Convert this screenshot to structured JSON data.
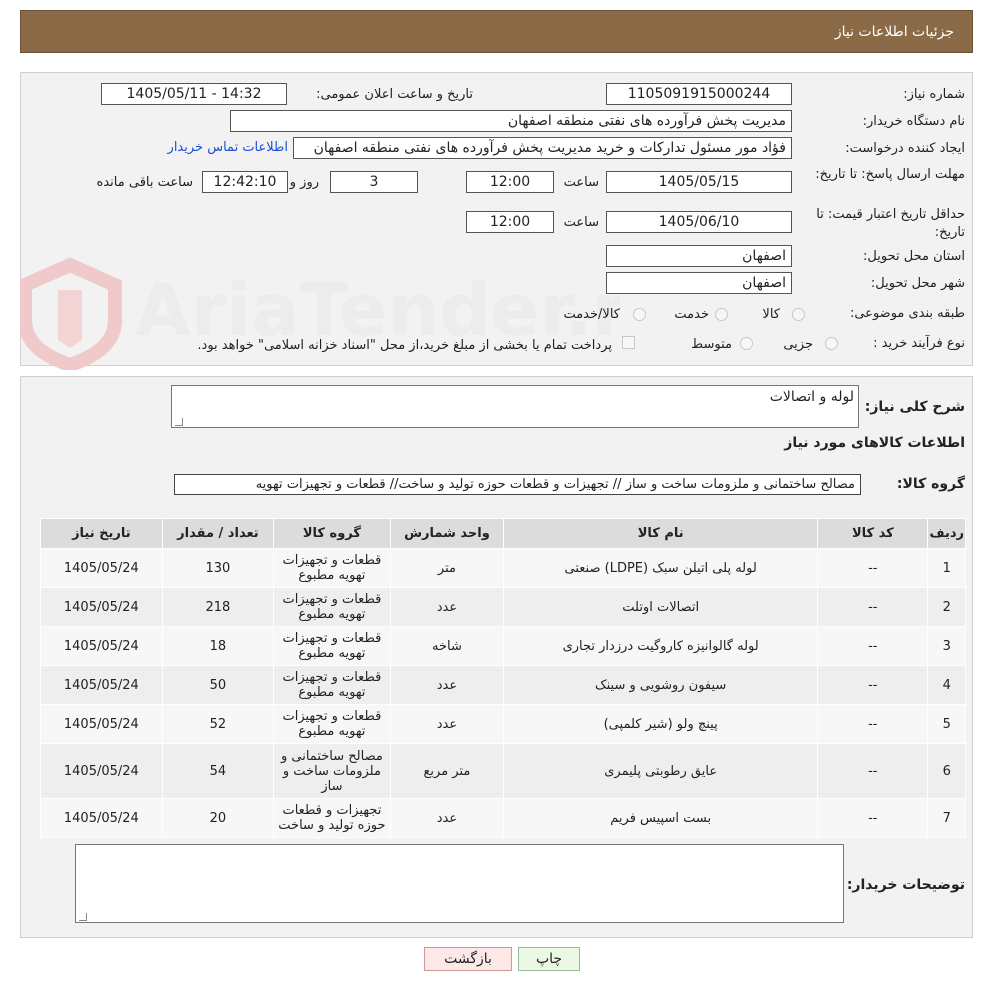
{
  "header": {
    "title": "جزئیات اطلاعات نیاز"
  },
  "form": {
    "need_number_label": "شماره نیاز:",
    "need_number": "1105091915000244",
    "announce_label": "تاریخ و ساعت اعلان عمومی:",
    "announce_value": "1405/05/11 - 14:32",
    "buyer_org_label": "نام دستگاه خریدار:",
    "buyer_org": "مدیریت پخش فرآورده های نفتی منطقه اصفهان",
    "requester_label": "ایجاد کننده درخواست:",
    "requester": "فؤاد مور مسئول تدارکات و خرید مدیریت پخش فرآورده های نفتی منطقه اصفهان",
    "contact_link": "اطلاعات تماس خریدار",
    "deadline_label": "مهلت ارسال پاسخ: تا تاریخ:",
    "deadline_date": "1405/05/15",
    "time_label": "ساعت",
    "deadline_time": "12:00",
    "days_value": "3",
    "days_label": "روز و",
    "remaining_time": "12:42:10",
    "remaining_label": "ساعت باقی مانده",
    "validity_label": "حداقل تاریخ اعتبار قیمت: تا تاریخ:",
    "validity_date": "1405/06/10",
    "validity_time": "12:00",
    "province_label": "استان محل تحویل:",
    "province": "اصفهان",
    "city_label": "شهر محل تحویل:",
    "city": "اصفهان",
    "category_label": "طبقه بندی موضوعی:",
    "category_options": [
      "کالا",
      "خدمت",
      "کالا/خدمت"
    ],
    "process_label": "نوع فرآیند خرید :",
    "process_options": [
      "جزیی",
      "متوسط"
    ],
    "payment_note": "پرداخت تمام یا بخشی از مبلغ خرید،از محل \"اسناد خزانه اسلامی\" خواهد بود."
  },
  "watermark": {
    "text": "AriaTender.neT"
  },
  "summary": {
    "label": "شرح کلی نیاز:",
    "value": "لوله و اتصالات",
    "goods_title": "اطلاعات کالاهای مورد نیاز",
    "group_label": "گروه کالا:",
    "group_value": "مصالح ساختمانی و ملزومات ساخت و ساز // تجهیزات و قطعات حوزه تولید و ساخت//  قطعات و تجهیزات تهویه"
  },
  "table": {
    "headers": [
      "ردیف",
      "کد کالا",
      "نام کالا",
      "واحد شمارش",
      "گروه کالا",
      "تعداد / مقدار",
      "تاریخ نیاز"
    ],
    "rows": [
      [
        "1",
        "--",
        "لوله پلی اتیلن سبک (LDPE) صنعتی",
        "متر",
        "قطعات و تجهیزات تهویه مطبوع",
        "130",
        "1405/05/24"
      ],
      [
        "2",
        "--",
        "اتصالات اوتلت",
        "عدد",
        "قطعات و تجهیزات تهویه مطبوع",
        "218",
        "1405/05/24"
      ],
      [
        "3",
        "--",
        "لوله گالوانیزه کاروگیت درزدار تجاری",
        "شاخه",
        "قطعات و تجهیزات تهویه مطبوع",
        "18",
        "1405/05/24"
      ],
      [
        "4",
        "--",
        "سیفون روشویی و سینک",
        "عدد",
        "قطعات و تجهیزات تهویه مطبوع",
        "50",
        "1405/05/24"
      ],
      [
        "5",
        "--",
        "پینچ ولو (شیر کلمپی)",
        "عدد",
        "قطعات و تجهیزات تهویه مطبوع",
        "52",
        "1405/05/24"
      ],
      [
        "6",
        "--",
        "عایق رطوبتی پلیمری",
        "متر مربع",
        "مصالح ساختمانی و ملزومات ساخت و ساز",
        "54",
        "1405/05/24"
      ],
      [
        "7",
        "--",
        "بست اسپیس فریم",
        "عدد",
        "تجهیزات و قطعات حوزه تولید و ساخت",
        "20",
        "1405/05/24"
      ]
    ]
  },
  "buyer_notes": {
    "label": "توضیحات خریدار:",
    "value": ""
  },
  "buttons": {
    "back": "بازگشت",
    "print": "چاپ"
  }
}
